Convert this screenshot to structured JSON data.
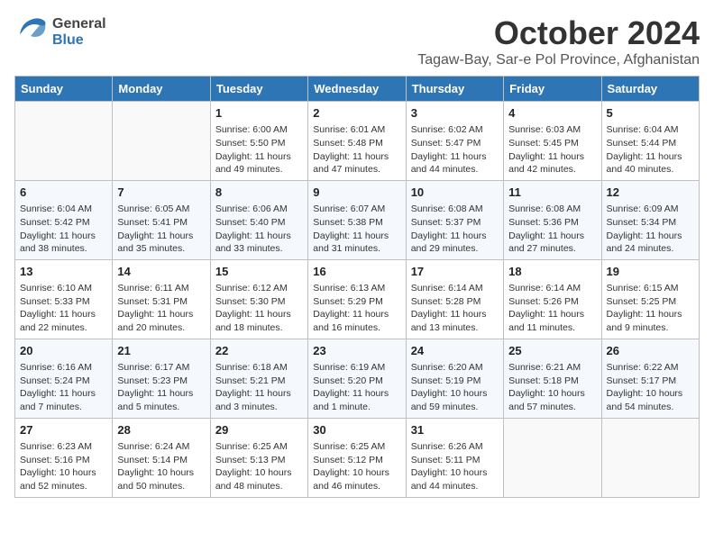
{
  "header": {
    "logo_general": "General",
    "logo_blue": "Blue",
    "month_title": "October 2024",
    "subtitle": "Tagaw-Bay, Sar-e Pol Province, Afghanistan"
  },
  "calendar": {
    "days_of_week": [
      "Sunday",
      "Monday",
      "Tuesday",
      "Wednesday",
      "Thursday",
      "Friday",
      "Saturday"
    ],
    "weeks": [
      [
        {
          "day": "",
          "info": ""
        },
        {
          "day": "",
          "info": ""
        },
        {
          "day": "1",
          "info": "Sunrise: 6:00 AM\nSunset: 5:50 PM\nDaylight: 11 hours and 49 minutes."
        },
        {
          "day": "2",
          "info": "Sunrise: 6:01 AM\nSunset: 5:48 PM\nDaylight: 11 hours and 47 minutes."
        },
        {
          "day": "3",
          "info": "Sunrise: 6:02 AM\nSunset: 5:47 PM\nDaylight: 11 hours and 44 minutes."
        },
        {
          "day": "4",
          "info": "Sunrise: 6:03 AM\nSunset: 5:45 PM\nDaylight: 11 hours and 42 minutes."
        },
        {
          "day": "5",
          "info": "Sunrise: 6:04 AM\nSunset: 5:44 PM\nDaylight: 11 hours and 40 minutes."
        }
      ],
      [
        {
          "day": "6",
          "info": "Sunrise: 6:04 AM\nSunset: 5:42 PM\nDaylight: 11 hours and 38 minutes."
        },
        {
          "day": "7",
          "info": "Sunrise: 6:05 AM\nSunset: 5:41 PM\nDaylight: 11 hours and 35 minutes."
        },
        {
          "day": "8",
          "info": "Sunrise: 6:06 AM\nSunset: 5:40 PM\nDaylight: 11 hours and 33 minutes."
        },
        {
          "day": "9",
          "info": "Sunrise: 6:07 AM\nSunset: 5:38 PM\nDaylight: 11 hours and 31 minutes."
        },
        {
          "day": "10",
          "info": "Sunrise: 6:08 AM\nSunset: 5:37 PM\nDaylight: 11 hours and 29 minutes."
        },
        {
          "day": "11",
          "info": "Sunrise: 6:08 AM\nSunset: 5:36 PM\nDaylight: 11 hours and 27 minutes."
        },
        {
          "day": "12",
          "info": "Sunrise: 6:09 AM\nSunset: 5:34 PM\nDaylight: 11 hours and 24 minutes."
        }
      ],
      [
        {
          "day": "13",
          "info": "Sunrise: 6:10 AM\nSunset: 5:33 PM\nDaylight: 11 hours and 22 minutes."
        },
        {
          "day": "14",
          "info": "Sunrise: 6:11 AM\nSunset: 5:31 PM\nDaylight: 11 hours and 20 minutes."
        },
        {
          "day": "15",
          "info": "Sunrise: 6:12 AM\nSunset: 5:30 PM\nDaylight: 11 hours and 18 minutes."
        },
        {
          "day": "16",
          "info": "Sunrise: 6:13 AM\nSunset: 5:29 PM\nDaylight: 11 hours and 16 minutes."
        },
        {
          "day": "17",
          "info": "Sunrise: 6:14 AM\nSunset: 5:28 PM\nDaylight: 11 hours and 13 minutes."
        },
        {
          "day": "18",
          "info": "Sunrise: 6:14 AM\nSunset: 5:26 PM\nDaylight: 11 hours and 11 minutes."
        },
        {
          "day": "19",
          "info": "Sunrise: 6:15 AM\nSunset: 5:25 PM\nDaylight: 11 hours and 9 minutes."
        }
      ],
      [
        {
          "day": "20",
          "info": "Sunrise: 6:16 AM\nSunset: 5:24 PM\nDaylight: 11 hours and 7 minutes."
        },
        {
          "day": "21",
          "info": "Sunrise: 6:17 AM\nSunset: 5:23 PM\nDaylight: 11 hours and 5 minutes."
        },
        {
          "day": "22",
          "info": "Sunrise: 6:18 AM\nSunset: 5:21 PM\nDaylight: 11 hours and 3 minutes."
        },
        {
          "day": "23",
          "info": "Sunrise: 6:19 AM\nSunset: 5:20 PM\nDaylight: 11 hours and 1 minute."
        },
        {
          "day": "24",
          "info": "Sunrise: 6:20 AM\nSunset: 5:19 PM\nDaylight: 10 hours and 59 minutes."
        },
        {
          "day": "25",
          "info": "Sunrise: 6:21 AM\nSunset: 5:18 PM\nDaylight: 10 hours and 57 minutes."
        },
        {
          "day": "26",
          "info": "Sunrise: 6:22 AM\nSunset: 5:17 PM\nDaylight: 10 hours and 54 minutes."
        }
      ],
      [
        {
          "day": "27",
          "info": "Sunrise: 6:23 AM\nSunset: 5:16 PM\nDaylight: 10 hours and 52 minutes."
        },
        {
          "day": "28",
          "info": "Sunrise: 6:24 AM\nSunset: 5:14 PM\nDaylight: 10 hours and 50 minutes."
        },
        {
          "day": "29",
          "info": "Sunrise: 6:25 AM\nSunset: 5:13 PM\nDaylight: 10 hours and 48 minutes."
        },
        {
          "day": "30",
          "info": "Sunrise: 6:25 AM\nSunset: 5:12 PM\nDaylight: 10 hours and 46 minutes."
        },
        {
          "day": "31",
          "info": "Sunrise: 6:26 AM\nSunset: 5:11 PM\nDaylight: 10 hours and 44 minutes."
        },
        {
          "day": "",
          "info": ""
        },
        {
          "day": "",
          "info": ""
        }
      ]
    ]
  }
}
